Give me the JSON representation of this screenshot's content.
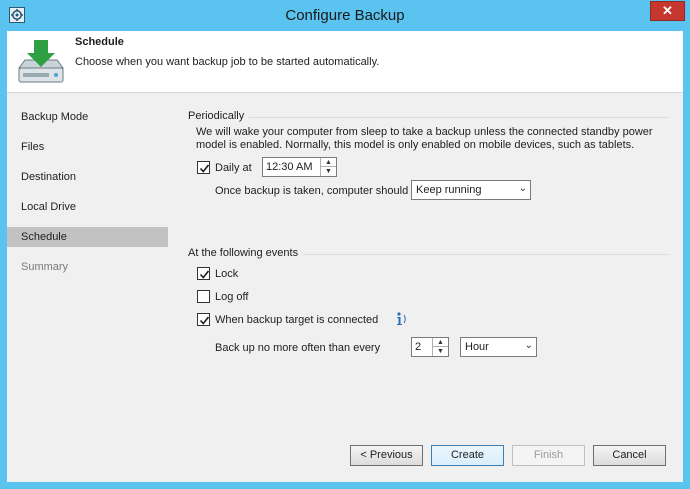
{
  "window": {
    "title": "Configure Backup",
    "close_label": "✕"
  },
  "header": {
    "title": "Schedule",
    "subtitle": "Choose when you want backup job to be started automatically."
  },
  "nav": {
    "items": [
      {
        "label": "Backup Mode",
        "state": "normal"
      },
      {
        "label": "Files",
        "state": "normal"
      },
      {
        "label": "Destination",
        "state": "normal"
      },
      {
        "label": "Local Drive",
        "state": "normal"
      },
      {
        "label": "Schedule",
        "state": "selected"
      },
      {
        "label": "Summary",
        "state": "disabled"
      }
    ]
  },
  "periodically": {
    "group_label": "Periodically",
    "description": "We will wake your computer from sleep to take a backup unless the connected standby power model is enabled. Normally, this model is only enabled on mobile devices, such as tablets.",
    "daily_label": "Daily at",
    "daily_checked": true,
    "time_value": "12:30 AM",
    "after_backup_label": "Once backup is taken, computer should",
    "after_backup_value": "Keep running"
  },
  "events": {
    "group_label": "At the following events",
    "lock_label": "Lock",
    "lock_checked": true,
    "logoff_label": "Log off",
    "logoff_checked": false,
    "target_label": "When backup target is connected",
    "target_checked": true,
    "frequency_label": "Back up no more often than every",
    "frequency_value": "2",
    "frequency_unit": "Hour"
  },
  "footer": {
    "previous_label": "< Previous",
    "create_label": "Create",
    "finish_label": "Finish",
    "cancel_label": "Cancel"
  },
  "colors": {
    "titlebar": "#5bc3ef",
    "close": "#c7372f",
    "selected_nav": "#c2c2c2",
    "icon_green": "#2ea043"
  }
}
